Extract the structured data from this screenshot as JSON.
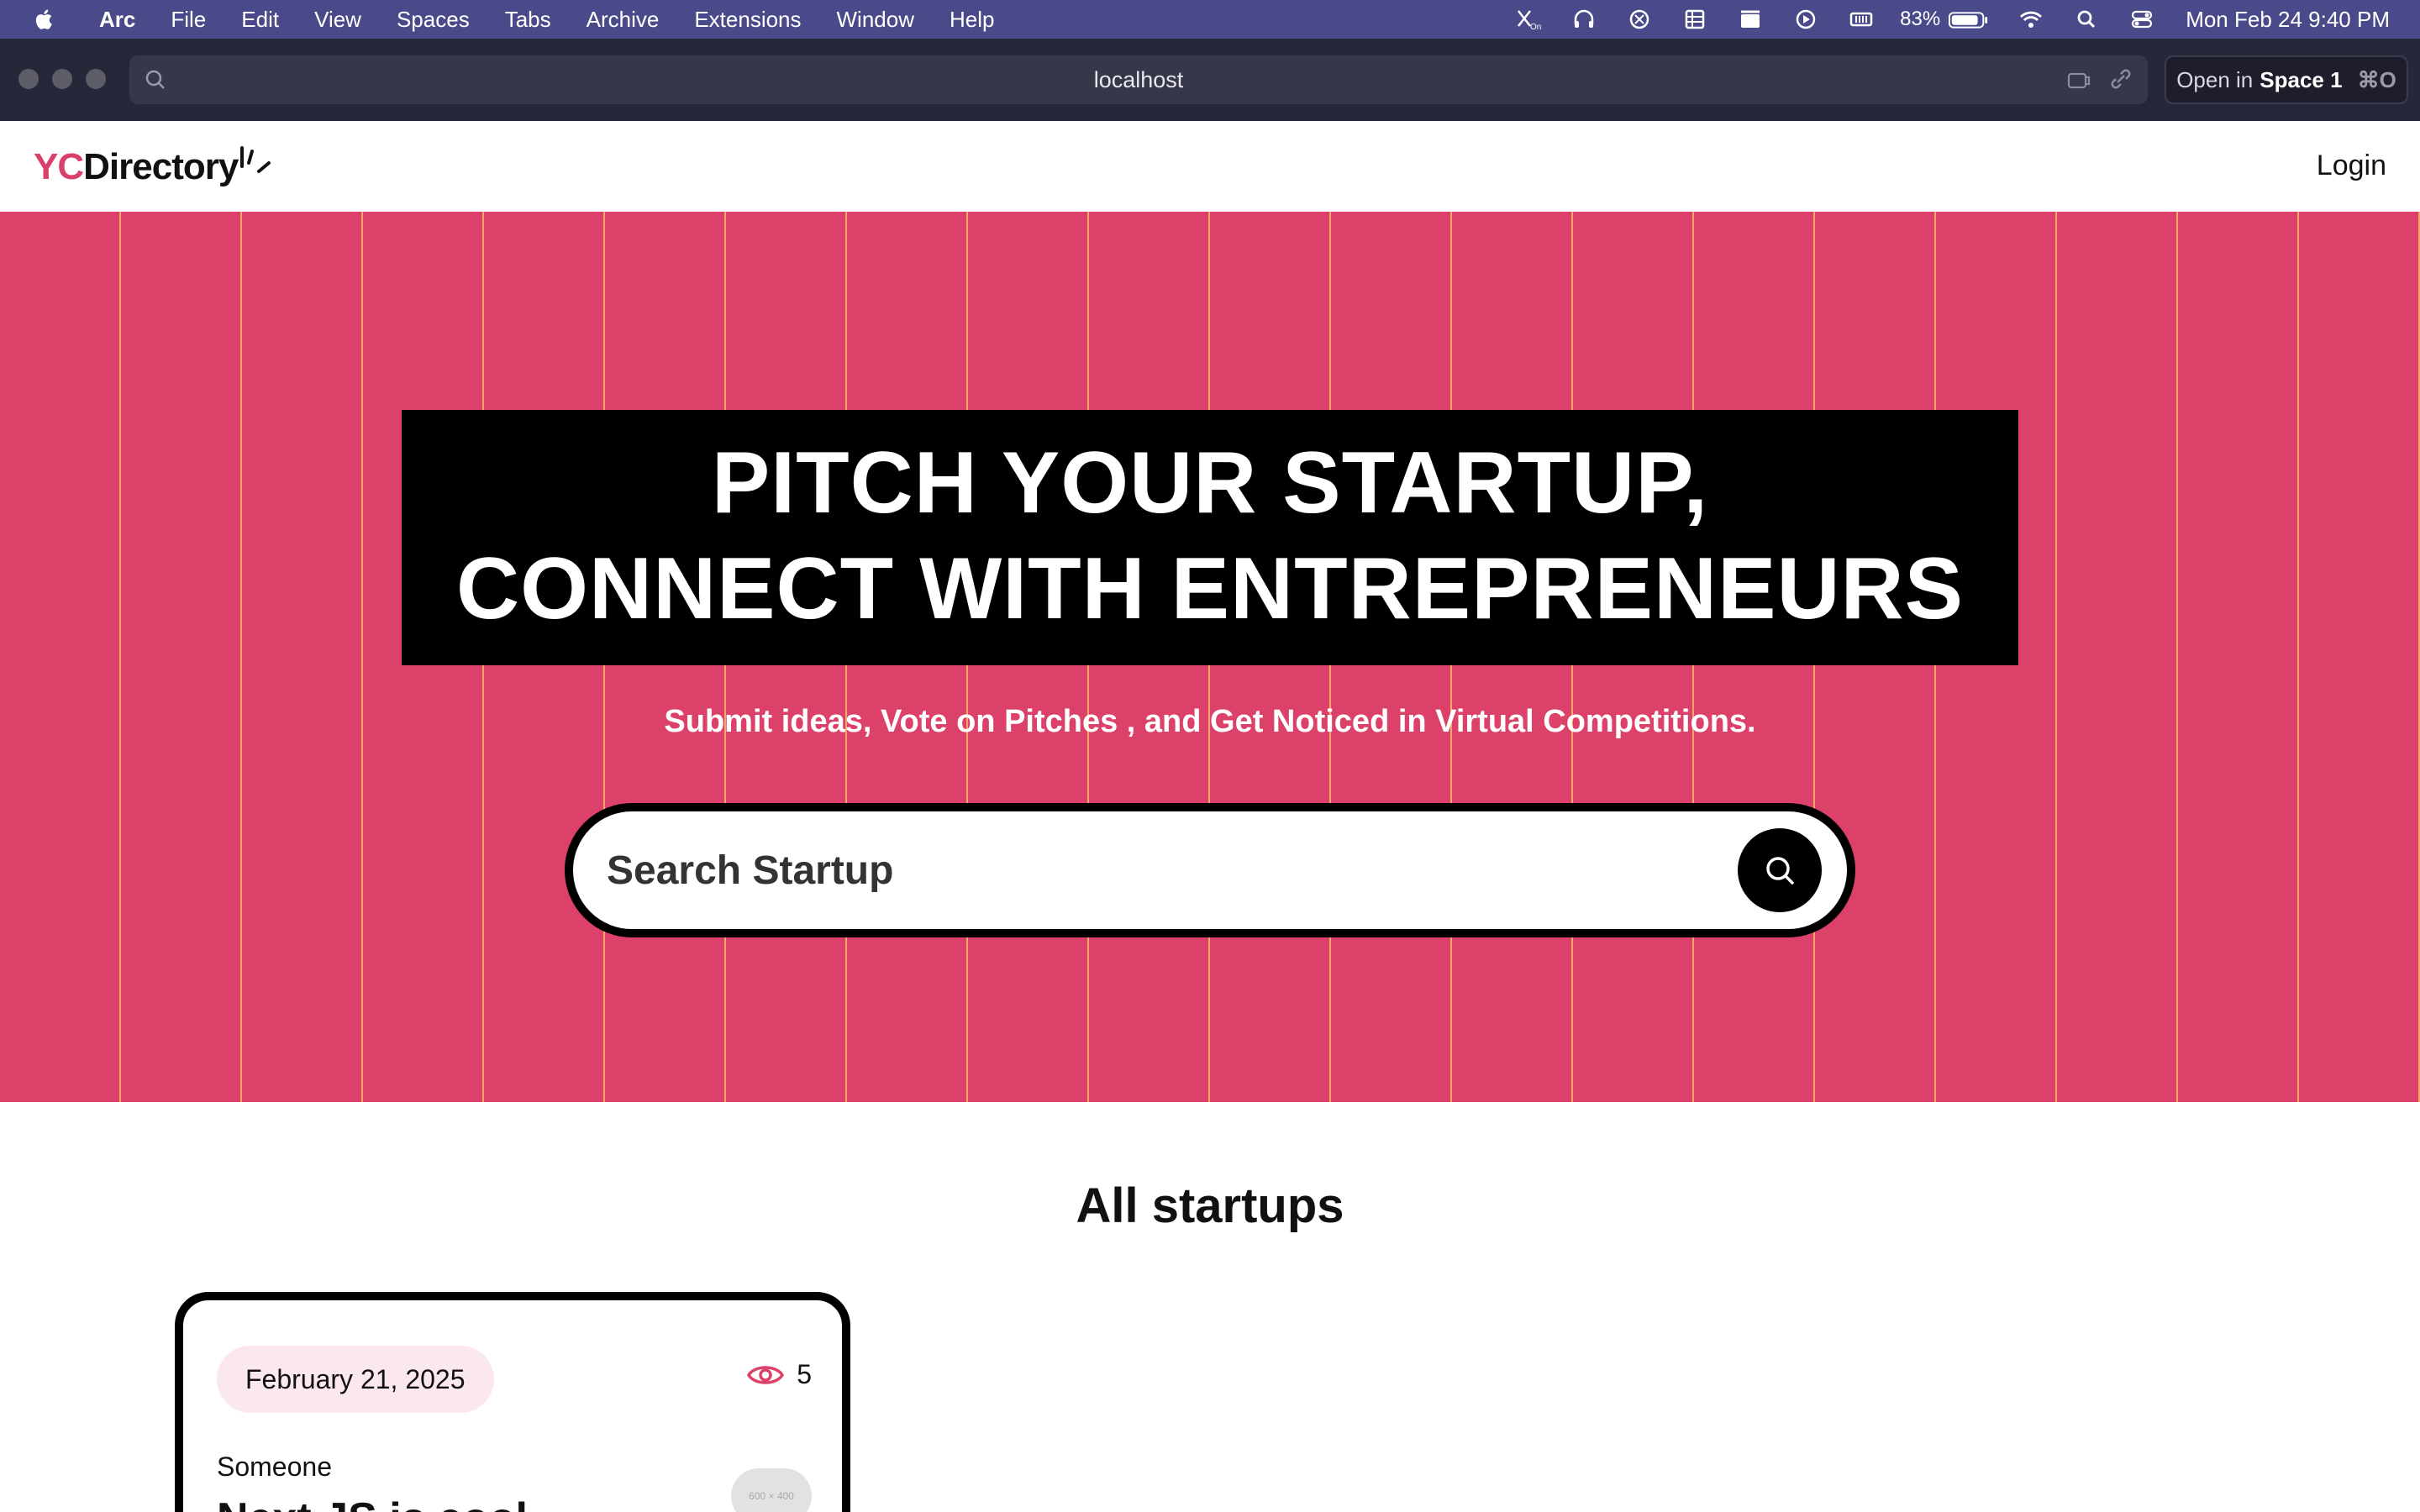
{
  "menubar": {
    "app_name": "Arc",
    "items": [
      "File",
      "Edit",
      "View",
      "Spaces",
      "Tabs",
      "Archive",
      "Extensions",
      "Window",
      "Help"
    ],
    "battery_percent": "83%",
    "clock": "Mon Feb 24  9:40 PM"
  },
  "browser": {
    "url": "localhost",
    "open_in_prefix": "Open in",
    "open_in_space": "Space 1",
    "open_in_shortcut": "⌘O"
  },
  "site": {
    "logo_prefix": "YC",
    "logo_suffix": "Directory",
    "login_label": "Login",
    "colors": {
      "primary": "#dc4169",
      "stripe": "#f5a66a",
      "badge": "#fbe8ee"
    }
  },
  "hero": {
    "headline_line1": "PITCH YOUR STARTUP,",
    "headline_line2": "CONNECT WITH ENTREPRENEURS",
    "subtitle": "Submit ideas, Vote on Pitches , and Get Noticed in Virtual Competitions.",
    "search_placeholder": "Search Startup"
  },
  "startups": {
    "section_title": "All startups",
    "cards": [
      {
        "date": "February 21, 2025",
        "views": "5",
        "author": "Someone",
        "title": "Next JS is cool",
        "thumb_text": "600 × 400"
      }
    ]
  }
}
